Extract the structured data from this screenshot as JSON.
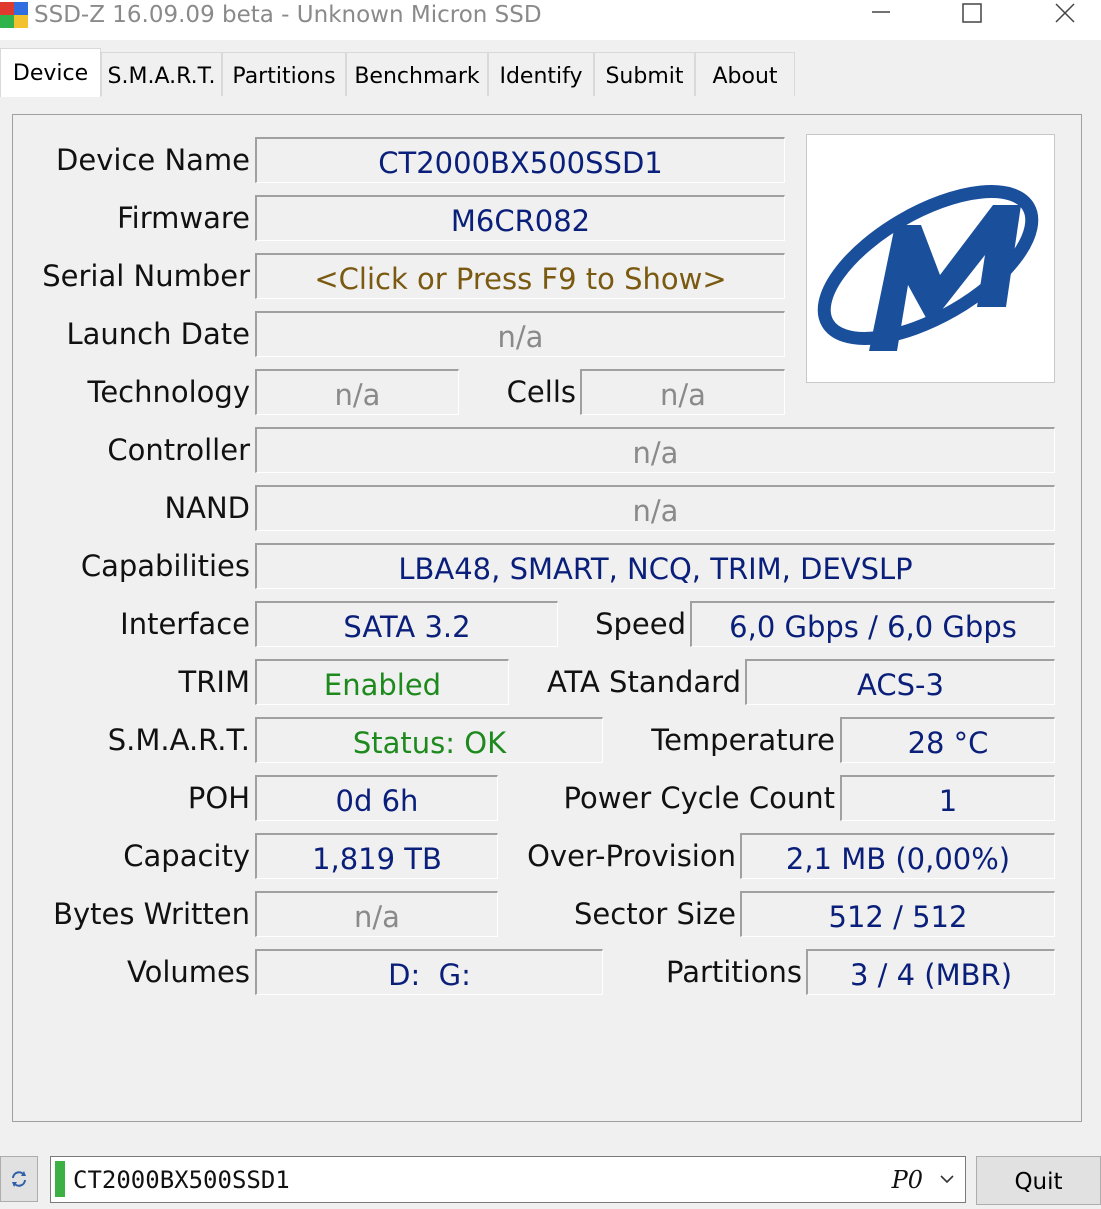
{
  "window": {
    "title": "SSD-Z 16.09.09 beta - Unknown Micron SSD"
  },
  "tabs": [
    {
      "label": "Device",
      "active": true
    },
    {
      "label": "S.M.A.R.T."
    },
    {
      "label": "Partitions"
    },
    {
      "label": "Benchmark"
    },
    {
      "label": "Identify"
    },
    {
      "label": "Submit"
    },
    {
      "label": "About"
    }
  ],
  "device": {
    "device_name": {
      "label": "Device Name",
      "value": "CT2000BX500SSD1"
    },
    "firmware": {
      "label": "Firmware",
      "value": "M6CR082"
    },
    "serial_number": {
      "label": "Serial Number",
      "value": "<Click or Press F9 to Show>"
    },
    "launch_date": {
      "label": "Launch Date",
      "value": "n/a"
    },
    "technology": {
      "label": "Technology",
      "value": "n/a"
    },
    "cells": {
      "label": "Cells",
      "value": "n/a"
    },
    "controller": {
      "label": "Controller",
      "value": "n/a"
    },
    "nand": {
      "label": "NAND",
      "value": "n/a"
    },
    "capabilities": {
      "label": "Capabilities",
      "value": "LBA48, SMART, NCQ, TRIM, DEVSLP"
    },
    "interface": {
      "label": "Interface",
      "value": "SATA 3.2"
    },
    "speed": {
      "label": "Speed",
      "value": "6,0 Gbps / 6,0 Gbps"
    },
    "trim": {
      "label": "TRIM",
      "value": "Enabled"
    },
    "ata_standard": {
      "label": "ATA Standard",
      "value": "ACS-3"
    },
    "smart": {
      "label": "S.M.A.R.T.",
      "value": "Status: OK"
    },
    "temperature": {
      "label": "Temperature",
      "value": "28 °C"
    },
    "poh": {
      "label": "POH",
      "value": "0d 6h"
    },
    "power_cycle_count": {
      "label": "Power Cycle Count",
      "value": "1"
    },
    "capacity": {
      "label": "Capacity",
      "value": "1,819 TB"
    },
    "over_provision": {
      "label": "Over-Provision",
      "value": "2,1 MB (0,00%)"
    },
    "bytes_written": {
      "label": "Bytes Written",
      "value": "n/a"
    },
    "sector_size": {
      "label": "Sector Size",
      "value": "512 / 512"
    },
    "volumes": {
      "label": "Volumes",
      "value": "D:  G:"
    },
    "partitions": {
      "label": "Partitions",
      "value": "3 / 4 (MBR)"
    }
  },
  "bottom": {
    "selected_drive": "CT2000BX500SSD1",
    "port": "P0",
    "quit_label": "Quit"
  },
  "colors": {
    "value_blue": "#0a1f7a",
    "value_gray": "#8a8a8a",
    "value_green": "#1e8a1e",
    "value_brown": "#7a5a10",
    "micron_logo": "#1a4f9c",
    "drive_indicator": "#3cb043"
  },
  "icons": {
    "app": "ssd-z-app-icon",
    "logo": "micron-logo",
    "refresh": "refresh-icon",
    "combo_arrow": "chevron-down-icon"
  }
}
